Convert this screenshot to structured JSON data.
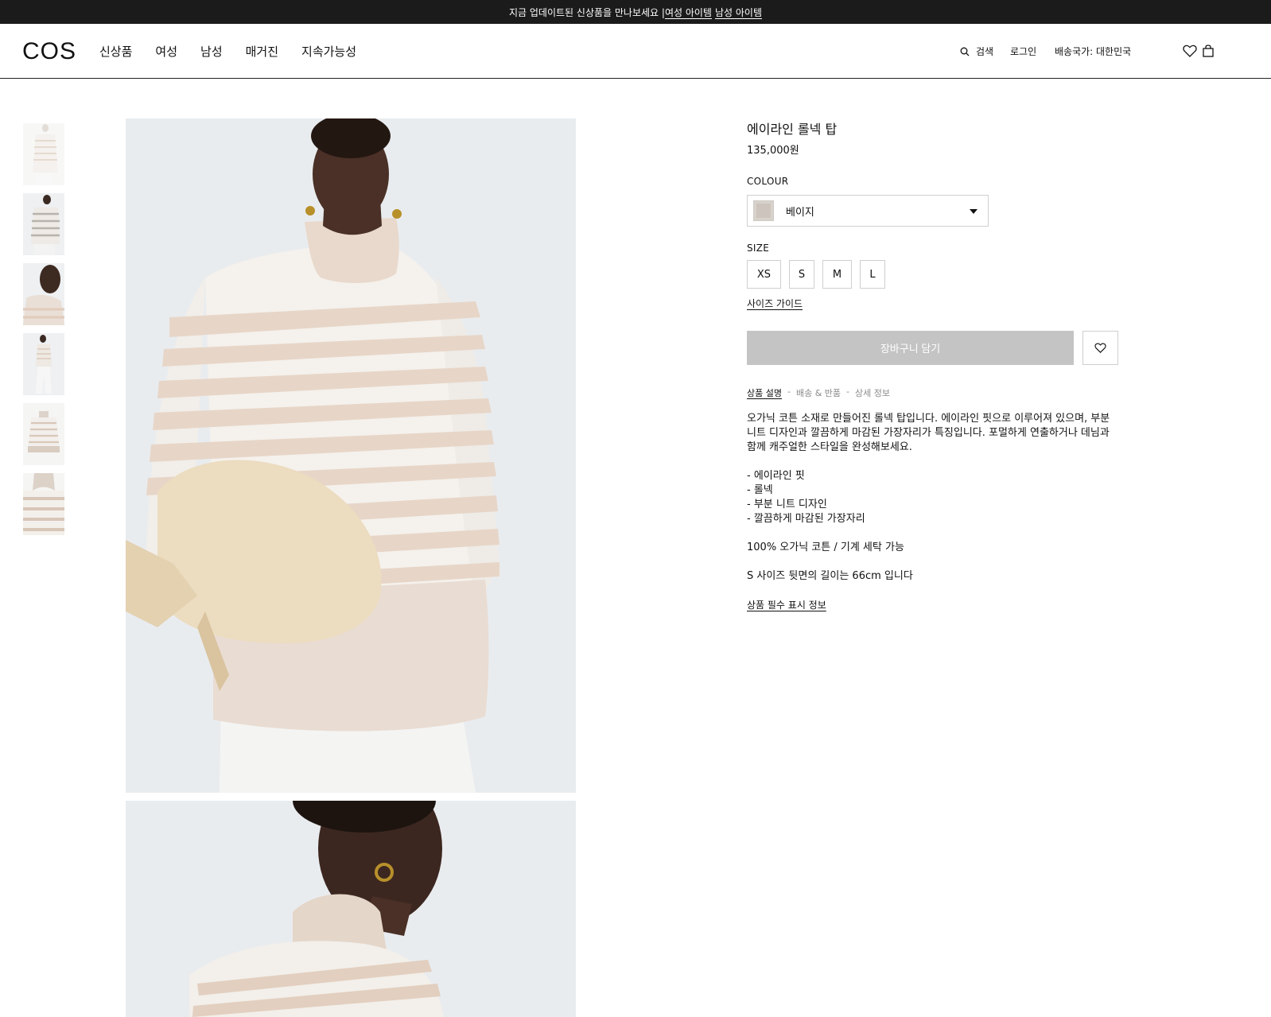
{
  "announcement": {
    "text": "지금 업데이트된 신상품을 만나보세요 | ",
    "link_women": "여성 아이템",
    "link_men": "남성 아이템"
  },
  "header": {
    "logo": "COS",
    "nav": [
      "신상품",
      "여성",
      "남성",
      "매거진",
      "지속가능성"
    ],
    "search_label": "검색",
    "login_label": "로그인",
    "country_label": "배송국가: 대한민국"
  },
  "product": {
    "title": "에이라인 롤넥 탑",
    "price": "135,000원",
    "colour_label": "COLOUR",
    "colour_value": "베이지",
    "size_label": "SIZE",
    "sizes": [
      "XS",
      "S",
      "M",
      "L"
    ],
    "size_guide": "사이즈 가이드",
    "add_to_cart": "장바구니 담기",
    "tabs": [
      "상품 설명",
      "배송 & 반품",
      "상세 정보"
    ],
    "tab_separator": "-",
    "description": "오가닉 코튼 소재로 만들어진 롤넥 탑입니다. 에이라인 핏으로 이루어져 있으며, 부분 니트 디자인과 깔끔하게 마감된 가장자리가 특징입니다. 포멀하게 연출하거나 데님과 함께 캐주얼한 스타일을 완성해보세요.",
    "bullets": [
      "- 에이라인 핏",
      "- 롤넥",
      "- 부분 니트 디자인",
      "- 깔끔하게 마감된 가장자리"
    ],
    "composition": "100% 오가닉 코튼 / 기계 세탁 가능",
    "length_note": "S 사이즈 뒷면의 길이는 66cm 입니다",
    "required_info": "상품 필수 표시 정보"
  },
  "icons": {
    "search": "search-icon",
    "wishlist": "heart-icon",
    "bag": "shopping-bag-icon",
    "dropdown": "caret-down-icon"
  },
  "colors": {
    "announcement_bg": "#1b1b1b",
    "button_disabled": "#c4c4c4",
    "image_bg": "#eef0f2",
    "stripe_beige": "#e7d6c8"
  }
}
